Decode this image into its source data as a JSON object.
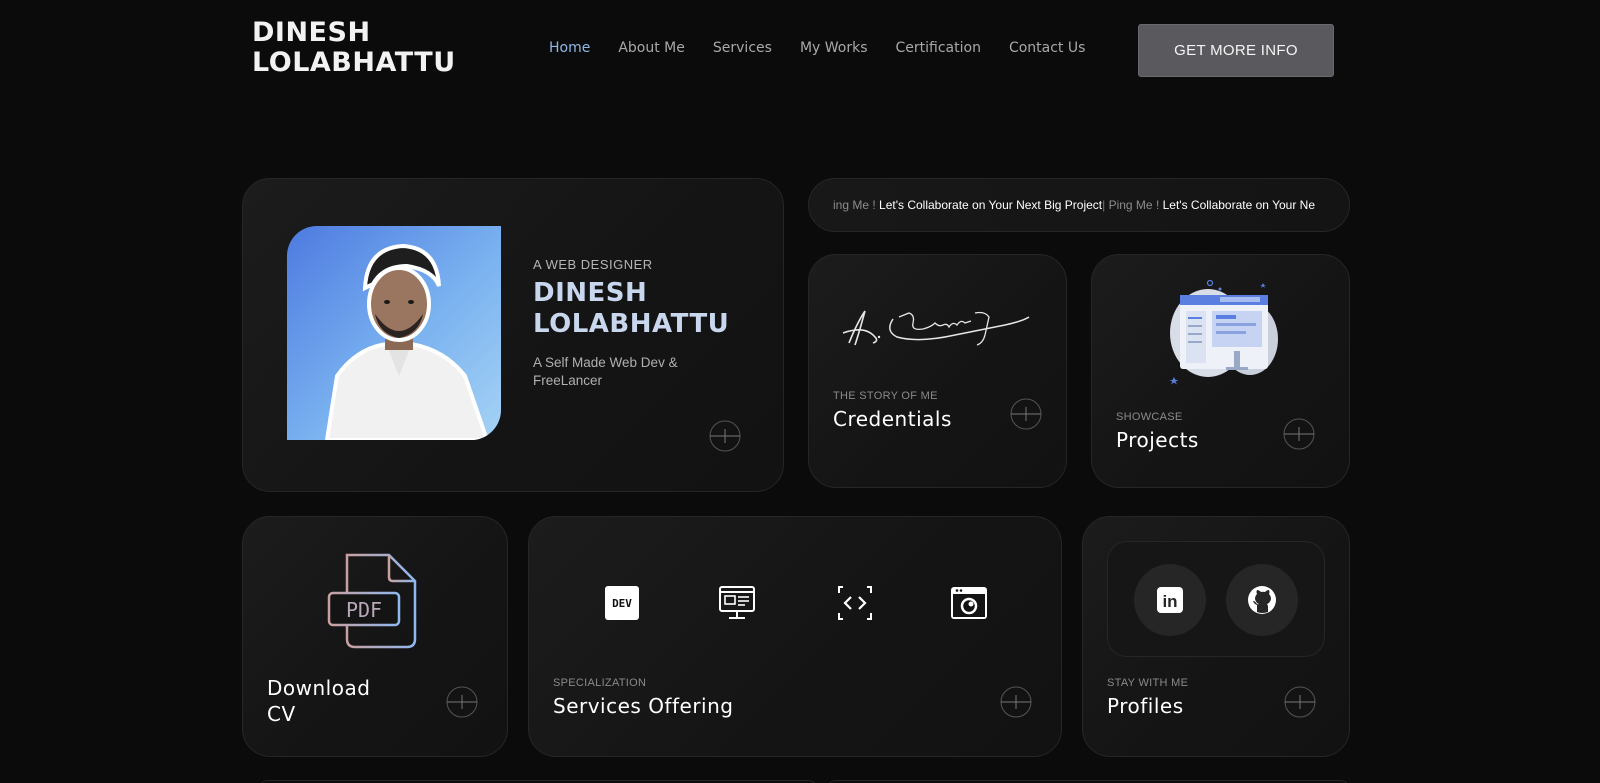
{
  "header": {
    "logo_line1": "DINESH",
    "logo_line2": "LOLABHATTU",
    "nav": [
      "Home",
      "About Me",
      "Services",
      "My Works",
      "Certification",
      "Contact Us"
    ],
    "cta_label": "GET MORE INFO"
  },
  "hero": {
    "subtitle": "A WEB DESIGNER",
    "name_line1": "DINESH",
    "name_line2": "LOLABHATTU",
    "description": "A Self Made Web Dev & FreeLancer"
  },
  "marquee": {
    "part1_dim": "ing Me ! ",
    "part1_bright": "Let's Collaborate on Your Next Big Project",
    "part2_dim": " Ping Me ! ",
    "part2_bright": "Let's Collaborate on Your Ne"
  },
  "credentials": {
    "label": "THE STORY OF ME",
    "title": "Credentials"
  },
  "projects": {
    "label": "SHOWCASE",
    "title": "Projects"
  },
  "cv": {
    "title_line1": "Download",
    "title_line2": "CV",
    "pdf_text": "PDF"
  },
  "services": {
    "label": "SPECIALIZATION",
    "title": "Services Offering",
    "icons": [
      "dev-icon",
      "monitor-icon",
      "code-icon",
      "browser-icon"
    ],
    "dev_text": "DEV"
  },
  "profiles": {
    "label": "STAY WITH ME",
    "title": "Profiles",
    "linkedin_text": "in"
  },
  "colors": {
    "accent": "#8fb8e8",
    "background": "#0b0b0b",
    "card": "#161616",
    "cta": "#5a595e"
  }
}
